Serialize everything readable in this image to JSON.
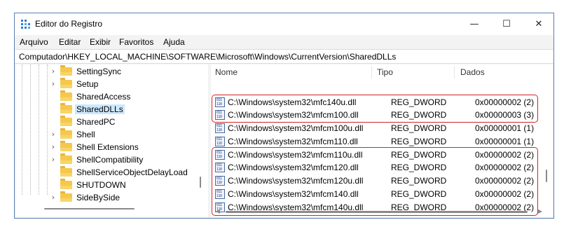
{
  "window": {
    "title": "Editor do Registro",
    "title_icon": "registry-icon"
  },
  "window_controls": {
    "minimize": "—",
    "maximize": "☐",
    "close": "✕"
  },
  "menu": [
    "Arquivo",
    "Editar",
    "Exibir",
    "Favoritos",
    "Ajuda"
  ],
  "address": "Computador\\HKEY_LOCAL_MACHINE\\SOFTWARE\\Microsoft\\Windows\\CurrentVersion\\SharedDLLs",
  "tree": {
    "items": [
      {
        "label": "SettingSync",
        "expander": "›"
      },
      {
        "label": "Setup",
        "expander": "›"
      },
      {
        "label": "SharedAccess",
        "expander": ""
      },
      {
        "label": "SharedDLLs",
        "expander": "",
        "selected": true
      },
      {
        "label": "SharedPC",
        "expander": ""
      },
      {
        "label": "Shell",
        "expander": "›"
      },
      {
        "label": "Shell Extensions",
        "expander": "›"
      },
      {
        "label": "ShellCompatibility",
        "expander": "›"
      },
      {
        "label": "ShellServiceObjectDelayLoad",
        "expander": ""
      },
      {
        "label": "SHUTDOWN",
        "expander": ""
      },
      {
        "label": "SideBySide",
        "expander": "›"
      }
    ]
  },
  "list": {
    "columns": {
      "name": "Nome",
      "type": "Tipo",
      "data": "Dados"
    },
    "rows": [
      {
        "name": "C:\\Windows\\system32\\mfc140u.dll",
        "type": "REG_DWORD",
        "data": "0x00000002 (2)",
        "highlighted": true
      },
      {
        "name": "C:\\Windows\\system32\\mfcm100.dll",
        "type": "REG_DWORD",
        "data": "0x00000003 (3)",
        "highlighted": true
      },
      {
        "name": "C:\\Windows\\system32\\mfcm100u.dll",
        "type": "REG_DWORD",
        "data": "0x00000001 (1)",
        "highlighted": false
      },
      {
        "name": "C:\\Windows\\system32\\mfcm110.dll",
        "type": "REG_DWORD",
        "data": "0x00000001 (1)",
        "highlighted": false
      },
      {
        "name": "C:\\Windows\\system32\\mfcm110u.dll",
        "type": "REG_DWORD",
        "data": "0x00000002 (2)",
        "highlighted": true
      },
      {
        "name": "C:\\Windows\\system32\\mfcm120.dll",
        "type": "REG_DWORD",
        "data": "0x00000002 (2)",
        "highlighted": true
      },
      {
        "name": "C:\\Windows\\system32\\mfcm120u.dll",
        "type": "REG_DWORD",
        "data": "0x00000002 (2)",
        "highlighted": true
      },
      {
        "name": "C:\\Windows\\system32\\mfcm140.dll",
        "type": "REG_DWORD",
        "data": "0x00000002 (2)",
        "highlighted": true
      },
      {
        "name": "C:\\Windows\\system32\\mfcm140u.dll",
        "type": "REG_DWORD",
        "data": "0x00000002 (2)",
        "highlighted": true
      }
    ]
  },
  "colors": {
    "highlight_border": "#d1232a",
    "selected_bg": "#cce8ff",
    "folder": "#f5c84c"
  }
}
